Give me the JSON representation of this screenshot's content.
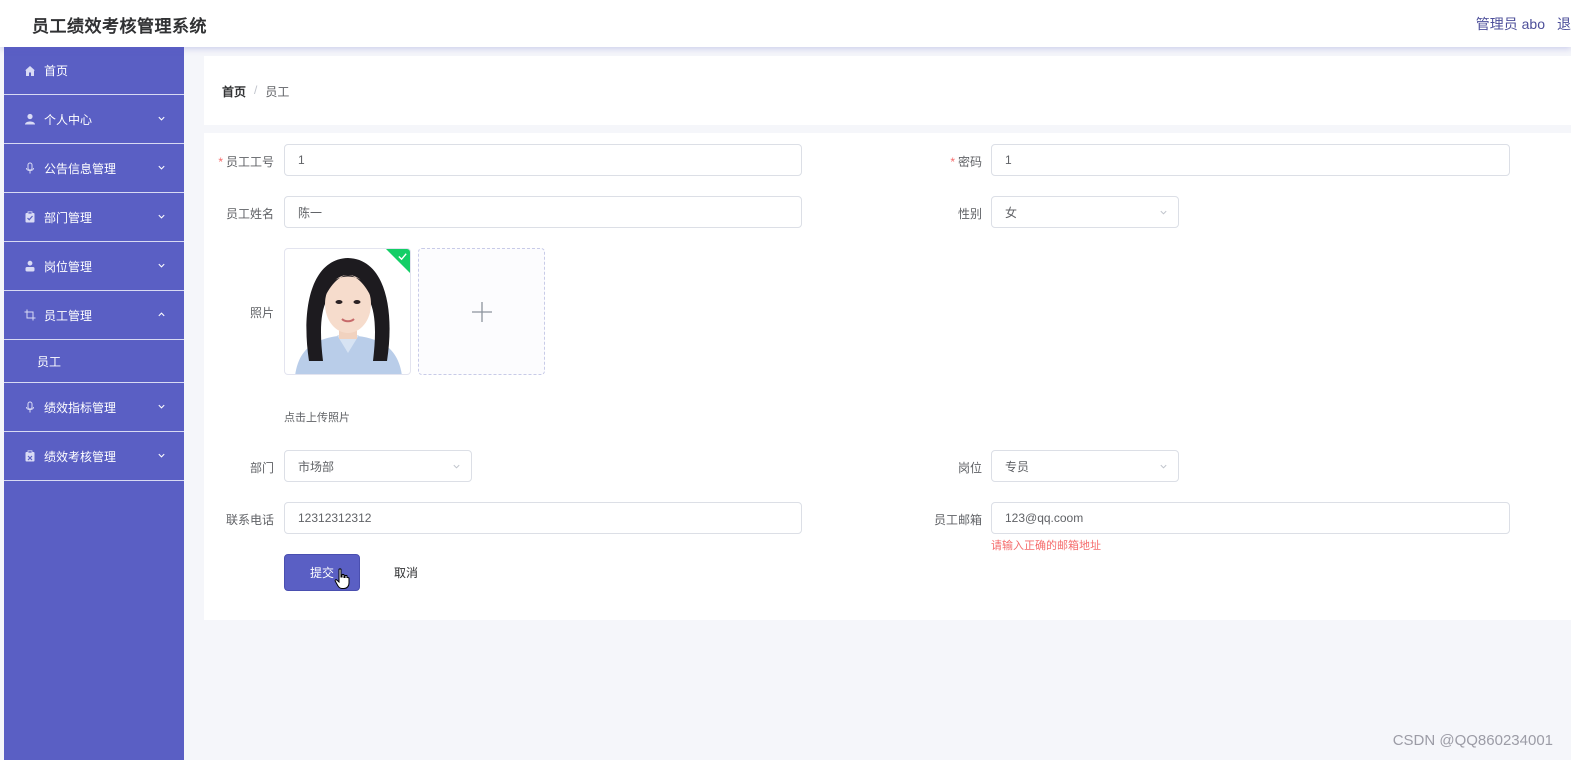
{
  "header": {
    "app_title": "员工绩效考核管理系统",
    "user_label": "管理员 abo",
    "edge_glyph": "退"
  },
  "sidebar": {
    "items": [
      {
        "label": "首页",
        "icon": "home-icon"
      },
      {
        "label": "个人中心",
        "icon": "user-icon"
      },
      {
        "label": "公告信息管理",
        "icon": "microphone-icon"
      },
      {
        "label": "部门管理",
        "icon": "clipboard-icon"
      },
      {
        "label": "岗位管理",
        "icon": "person-icon"
      },
      {
        "label": "员工管理",
        "icon": "crop-icon",
        "expanded": true
      },
      {
        "label": "绩效指标管理",
        "icon": "microphone-icon"
      },
      {
        "label": "绩效考核管理",
        "icon": "clipboard-icon"
      }
    ],
    "subitems": {
      "staff": "员工"
    }
  },
  "breadcrumb": {
    "home": "首页",
    "separator": "/",
    "current": "员工"
  },
  "form": {
    "employee_no": {
      "label": "员工工号",
      "value": "1",
      "required": true
    },
    "password": {
      "label": "密码",
      "value": "1",
      "required": true
    },
    "name": {
      "label": "员工姓名",
      "value": "陈一"
    },
    "gender": {
      "label": "性别",
      "value": "女"
    },
    "photo": {
      "label": "照片",
      "tip": "点击上传照片",
      "add_icon": "plus-icon",
      "status_icon": "check-icon"
    },
    "department": {
      "label": "部门",
      "value": "市场部"
    },
    "position": {
      "label": "岗位",
      "value": "专员"
    },
    "phone": {
      "label": "联系电话",
      "value": "12312312312"
    },
    "email": {
      "label": "员工邮箱",
      "value": "123@qq.coom",
      "error": "请输入正确的邮箱地址"
    },
    "submit_label": "提交",
    "cancel_label": "取消"
  },
  "watermark": "CSDN @QQ860234001",
  "colors": {
    "accent": "#5a5fc4",
    "error": "#f56c6c",
    "success": "#13ce66"
  }
}
